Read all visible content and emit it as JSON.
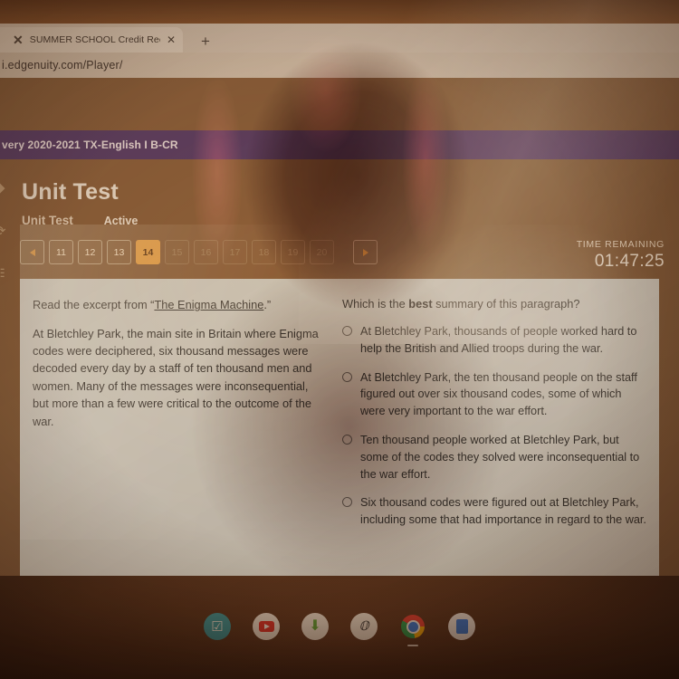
{
  "browser": {
    "tab": {
      "favicon": "x-mark-icon",
      "title": "SUMMER SCHOOL Credit Recove",
      "close_label": "✕"
    },
    "new_tab_label": "+",
    "url": "i.edgenuity.com/Player/"
  },
  "course": {
    "banner_title": "very 2020-2021 TX-English I B-CR",
    "banner_color": "#5f4572"
  },
  "lesson": {
    "title": "Unit Test",
    "subtitle": "Unit Test",
    "status": "Active"
  },
  "pager": {
    "prev_label": "◀",
    "next_label": "▶",
    "active_value": "14",
    "active_color": "#f0a952",
    "items": [
      {
        "label": "11",
        "state": "normal"
      },
      {
        "label": "12",
        "state": "normal"
      },
      {
        "label": "13",
        "state": "normal"
      },
      {
        "label": "14",
        "state": "active"
      },
      {
        "label": "15",
        "state": "dim"
      },
      {
        "label": "16",
        "state": "dim"
      },
      {
        "label": "17",
        "state": "dim"
      },
      {
        "label": "18",
        "state": "dim"
      },
      {
        "label": "19",
        "state": "dim"
      },
      {
        "label": "20",
        "state": "dim"
      }
    ]
  },
  "timer": {
    "label": "TIME REMAINING",
    "value": "01:47:25"
  },
  "passage": {
    "prompt_before": "Read the excerpt from “",
    "prompt_link": "The Enigma Machine",
    "prompt_after": ".”",
    "body": "At Bletchley Park, the main site in Britain where Enigma codes were deciphered, six thousand messages were decoded every day by a staff of ten thousand men and women. Many of the messages were inconsequential, but more than a few were critical to the outcome of the war."
  },
  "question": {
    "text_before": "Which is the ",
    "emphasis": "best",
    "text_after": " summary of this paragraph?",
    "options": [
      {
        "id": "A",
        "text": "At Bletchley Park, thousands of people worked hard to help the British and Allied troops during the war.",
        "selected": false
      },
      {
        "id": "B",
        "text": "At Bletchley Park, the ten thousand people on the staff figured out over six thousand codes, some of which were very important to the war effort.",
        "selected": false
      },
      {
        "id": "C",
        "text": "Ten thousand people worked at Bletchley Park, but some of the codes they solved were inconsequential to the war effort.",
        "selected": false
      },
      {
        "id": "D",
        "text": "Six thousand codes were figured out at Bletchley Park, including some that had importance in regard to the war.",
        "selected": false
      }
    ]
  },
  "taskbar": {
    "items": [
      {
        "name": "checklist-app-icon",
        "active": false
      },
      {
        "name": "youtube-icon",
        "active": false
      },
      {
        "name": "download-arrow-icon",
        "active": false
      },
      {
        "name": "sketch-pen-icon",
        "active": false
      },
      {
        "name": "chrome-icon",
        "active": true
      },
      {
        "name": "docs-file-icon",
        "active": false
      }
    ]
  },
  "edge_icons": [
    "home-icon",
    "refresh-icon",
    "notes-icon"
  ]
}
